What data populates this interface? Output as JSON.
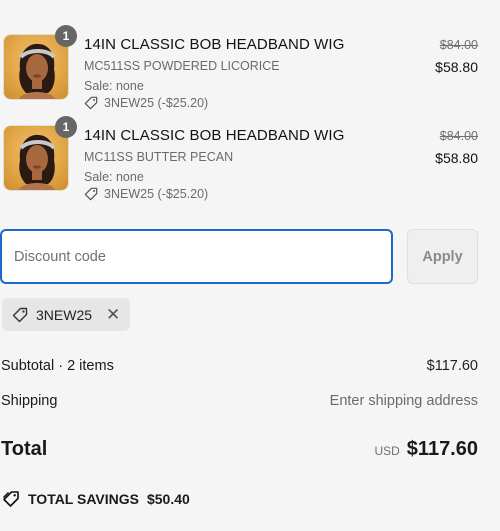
{
  "items": [
    {
      "quantity": "1",
      "title": "14IN CLASSIC BOB HEADBAND WIG",
      "variant": "MC511SS POWDERED LICORICE",
      "sale": "Sale: none",
      "discount": "3NEW25 (-$25.20)",
      "original_price": "$84.00",
      "price": "$58.80"
    },
    {
      "quantity": "1",
      "title": "14IN CLASSIC BOB HEADBAND WIG",
      "variant": "MC11SS BUTTER PECAN",
      "sale": "Sale: none",
      "discount": "3NEW25 (-$25.20)",
      "original_price": "$84.00",
      "price": "$58.80"
    }
  ],
  "discount_form": {
    "placeholder": "Discount code",
    "apply_label": "Apply"
  },
  "applied_code": {
    "code": "3NEW25",
    "remove_icon": "close-icon"
  },
  "summary": {
    "subtotal_label": "Subtotal · 2 items",
    "subtotal_value": "$117.60",
    "shipping_label": "Shipping",
    "shipping_value": "Enter shipping address",
    "total_label": "Total",
    "currency": "USD",
    "total_value": "$117.60"
  },
  "savings": {
    "label": "TOTAL SAVINGS",
    "value": "$50.40"
  },
  "colors": {
    "focus_border": "#1b6ac9",
    "background": "#f5f5f5",
    "badge": "#666666"
  }
}
